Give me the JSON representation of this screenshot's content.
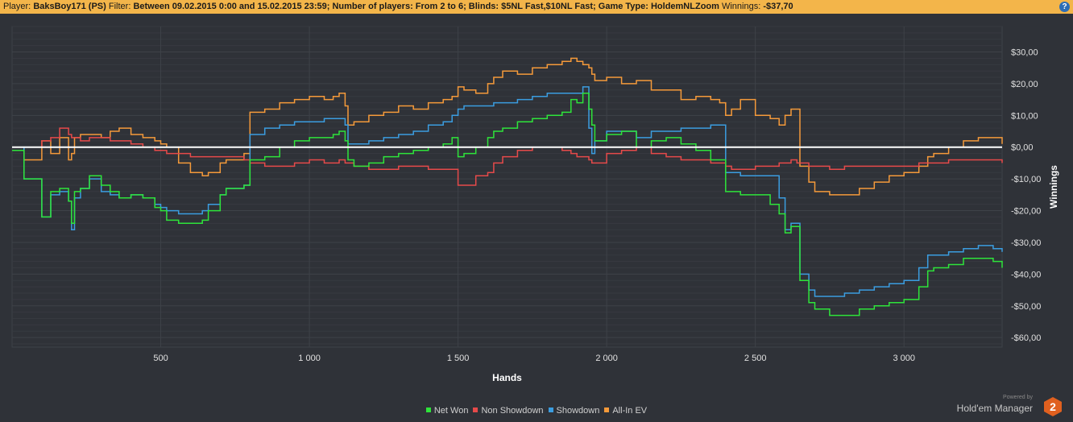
{
  "header": {
    "player_label": "Player:",
    "player_value": "BaksBoy171 (PS)",
    "filter_label": "Filter:",
    "filter_value": "Between 09.02.2015 0:00 and 15.02.2015 23:59; Number of players: From 2 to 6; Blinds: $5NL Fast,$10NL Fast; Game Type: HoldemNLZoom",
    "winnings_label": "Winnings:",
    "winnings_value": "-$37,70",
    "help_label": "?"
  },
  "brand": {
    "powered": "Powered by",
    "name": "Hold'em Manager",
    "badge": "2"
  },
  "colors": {
    "background": "#2f3238",
    "grid": "#3e4248",
    "zero_line": "#ffffff",
    "net_won": "#2ee43a",
    "non_showdown": "#e64a4a",
    "showdown": "#3b9de0",
    "all_in_ev": "#f59a3a",
    "header": "#f3b54a"
  },
  "chart_data": {
    "type": "line",
    "xlabel": "Hands",
    "ylabel": "Winnings",
    "xlim": [
      0,
      3330
    ],
    "ylim": [
      -63,
      38
    ],
    "x_ticks": [
      500,
      1000,
      1500,
      2000,
      2500,
      3000
    ],
    "x_tick_labels": [
      "500",
      "1 000",
      "1 500",
      "2 000",
      "2 500",
      "3 000"
    ],
    "y_ticks": [
      30,
      20,
      10,
      0,
      -10,
      -20,
      -30,
      -40,
      -50,
      -60
    ],
    "y_tick_labels": [
      "$30,00",
      "$20,00",
      "$10,00",
      "$0,00",
      "-$10,00",
      "-$20,00",
      "-$30,00",
      "-$40,00",
      "-$50,00",
      "-$60,00"
    ],
    "grid": true,
    "legend_position": "bottom",
    "x": [
      0,
      40,
      100,
      130,
      160,
      190,
      200,
      210,
      230,
      260,
      300,
      330,
      360,
      400,
      440,
      480,
      500,
      520,
      560,
      600,
      640,
      660,
      700,
      720,
      780,
      800,
      850,
      900,
      950,
      1000,
      1050,
      1080,
      1100,
      1120,
      1130,
      1150,
      1200,
      1250,
      1300,
      1350,
      1400,
      1450,
      1480,
      1500,
      1520,
      1560,
      1600,
      1620,
      1650,
      1700,
      1750,
      1800,
      1850,
      1880,
      1900,
      1920,
      1940,
      1950,
      1960,
      2000,
      2050,
      2100,
      2150,
      2200,
      2250,
      2300,
      2350,
      2380,
      2400,
      2420,
      2450,
      2500,
      2550,
      2580,
      2600,
      2620,
      2640,
      2650,
      2680,
      2700,
      2750,
      2800,
      2850,
      2900,
      2950,
      3000,
      3050,
      3080,
      3100,
      3150,
      3200,
      3250,
      3300,
      3330
    ],
    "series": [
      {
        "name": "Net Won",
        "color": "#2ee43a",
        "values": [
          -1,
          -10,
          -22,
          -14,
          -13,
          -17,
          -24,
          -14,
          -13,
          -9,
          -12,
          -14,
          -16,
          -15,
          -16,
          -19,
          -20,
          -23,
          -24,
          -24,
          -23,
          -20,
          -15,
          -13,
          -12,
          -4,
          -3,
          0,
          2,
          3,
          3,
          4,
          5,
          2,
          -4,
          -6,
          -5,
          -3,
          -2,
          -1,
          0,
          1,
          3,
          -3,
          -2,
          0,
          3,
          5,
          6,
          8,
          9,
          10,
          11,
          15,
          14,
          17,
          12,
          7,
          2,
          4,
          5,
          0,
          2,
          3,
          1,
          -1,
          -4,
          -4,
          -14,
          -14,
          -15,
          -15,
          -18,
          -21,
          -27,
          -25,
          -25,
          -42,
          -49,
          -51,
          -53,
          -53,
          -51,
          -50,
          -49,
          -48,
          -44,
          -39,
          -38,
          -37,
          -35,
          -35,
          -36,
          -38
        ]
      },
      {
        "name": "Non Showdown",
        "color": "#e64a4a",
        "values": [
          0,
          0,
          2,
          3,
          6,
          4,
          3,
          3,
          2,
          3,
          3,
          2,
          2,
          1,
          0,
          -1,
          -1,
          -2,
          -2,
          -3,
          -3,
          -3,
          -3,
          -3,
          -4,
          -5,
          -6,
          -6,
          -5,
          -4,
          -5,
          -5,
          -4,
          -5,
          -5,
          -6,
          -7,
          -7,
          -6,
          -6,
          -7,
          -7,
          -7,
          -12,
          -12,
          -9,
          -8,
          -5,
          -3,
          -1,
          0,
          0,
          -1,
          -2,
          -3,
          -3,
          -4,
          -5,
          -5,
          -2,
          -1,
          0,
          -2,
          -3,
          -4,
          -4,
          -5,
          -5,
          -6,
          -7,
          -7,
          -6,
          -6,
          -5,
          -5,
          -4,
          -5,
          -5,
          -6,
          -6,
          -7,
          -6,
          -6,
          -6,
          -6,
          -6,
          -5,
          -5,
          -5,
          -4,
          -4,
          -4,
          -4,
          -5
        ]
      },
      {
        "name": "Showdown",
        "color": "#3b9de0",
        "values": [
          0,
          -10,
          -22,
          -15,
          -14,
          -17,
          -26,
          -16,
          -13,
          -10,
          -14,
          -15,
          -16,
          -15,
          -16,
          -18,
          -19,
          -20,
          -21,
          -21,
          -20,
          -18,
          -15,
          -13,
          -12,
          4,
          6,
          7,
          8,
          8,
          9,
          9,
          9,
          7,
          1,
          1,
          2,
          3,
          4,
          5,
          7,
          8,
          10,
          12,
          13,
          13,
          13,
          14,
          14,
          15,
          16,
          17,
          17,
          17,
          17,
          19,
          6,
          -2,
          2,
          5,
          5,
          3,
          5,
          5,
          6,
          6,
          7,
          7,
          -8,
          -8,
          -9,
          -9,
          -9,
          -16,
          -26,
          -24,
          -24,
          -40,
          -45,
          -47,
          -47,
          -46,
          -45,
          -44,
          -43,
          -42,
          -38,
          -34,
          -34,
          -33,
          -32,
          -31,
          -32,
          -33
        ]
      },
      {
        "name": "All-In EV",
        "color": "#f59a3a",
        "values": [
          0,
          -4,
          2,
          -2,
          3,
          -4,
          -2,
          3,
          4,
          4,
          3,
          5,
          6,
          4,
          3,
          2,
          1,
          0,
          -5,
          -8,
          -9,
          -8,
          -5,
          -4,
          -2,
          11,
          12,
          14,
          15,
          16,
          15,
          16,
          17,
          13,
          7,
          8,
          10,
          11,
          13,
          12,
          14,
          15,
          16,
          19,
          18,
          17,
          20,
          22,
          24,
          23,
          25,
          26,
          27,
          28,
          27,
          26,
          25,
          23,
          21,
          22,
          20,
          21,
          18,
          18,
          15,
          16,
          15,
          14,
          10,
          12,
          15,
          10,
          9,
          7,
          10,
          12,
          12,
          -6,
          -11,
          -14,
          -15,
          -15,
          -13,
          -11,
          -9,
          -8,
          -6,
          -3,
          -2,
          0,
          2,
          3,
          3,
          1
        ]
      }
    ]
  }
}
